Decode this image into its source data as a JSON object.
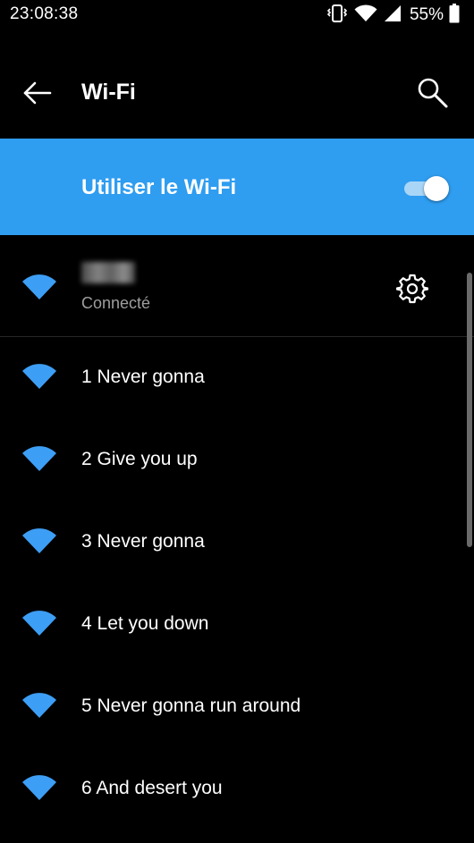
{
  "status_bar": {
    "time": "23:08:38",
    "battery_percent": "55%",
    "icons": [
      "vibrate-icon",
      "wifi-signal-icon",
      "cellular-signal-icon",
      "battery-icon"
    ]
  },
  "toolbar": {
    "title": "Wi-Fi",
    "back_icon": "arrow-left-icon",
    "search_icon": "search-icon"
  },
  "master_switch": {
    "label": "Utiliser le Wi-Fi",
    "enabled": true
  },
  "connected_network": {
    "status": "Connecté",
    "settings_icon": "gear-icon"
  },
  "networks": [
    {
      "name": "1 Never gonna"
    },
    {
      "name": "2 Give you up"
    },
    {
      "name": "3 Never gonna"
    },
    {
      "name": "4 Let you down"
    },
    {
      "name": "5 Never gonna run around"
    },
    {
      "name": "6 And desert you"
    }
  ],
  "colors": {
    "accent": "#2f9df0",
    "wifi_icon": "#3d9ef5",
    "background": "#000000",
    "secondary_text": "#9e9e9e"
  }
}
